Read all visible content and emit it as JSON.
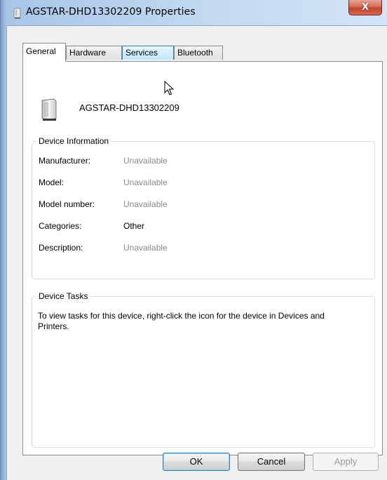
{
  "window": {
    "title": "AGSTAR-DHD13302209 Properties",
    "close_label": "X",
    "title_icon": "device-icon"
  },
  "tabs": [
    {
      "label": "General",
      "state": "selected"
    },
    {
      "label": "Hardware",
      "state": "normal"
    },
    {
      "label": "Services",
      "state": "hover"
    },
    {
      "label": "Bluetooth",
      "state": "normal"
    }
  ],
  "device": {
    "icon": "device-icon",
    "name": "AGSTAR-DHD13302209"
  },
  "device_information": {
    "legend": "Device Information",
    "rows": [
      {
        "label": "Manufacturer:",
        "value": "Unavailable"
      },
      {
        "label": "Model:",
        "value": "Unavailable"
      },
      {
        "label": "Model number:",
        "value": "Unavailable"
      },
      {
        "label": "Categories:",
        "value": "Other"
      },
      {
        "label": "Description:",
        "value": "Unavailable"
      }
    ]
  },
  "device_tasks": {
    "legend": "Device Tasks",
    "text": "To view tasks for this device, right-click the icon for the device in Devices and Printers."
  },
  "buttons": {
    "ok": "OK",
    "cancel": "Cancel",
    "apply": "Apply"
  },
  "colors": {
    "accent": "#3c7fb1",
    "unavailable_text": "#8a8a8a",
    "close_button": "#c2432a"
  }
}
